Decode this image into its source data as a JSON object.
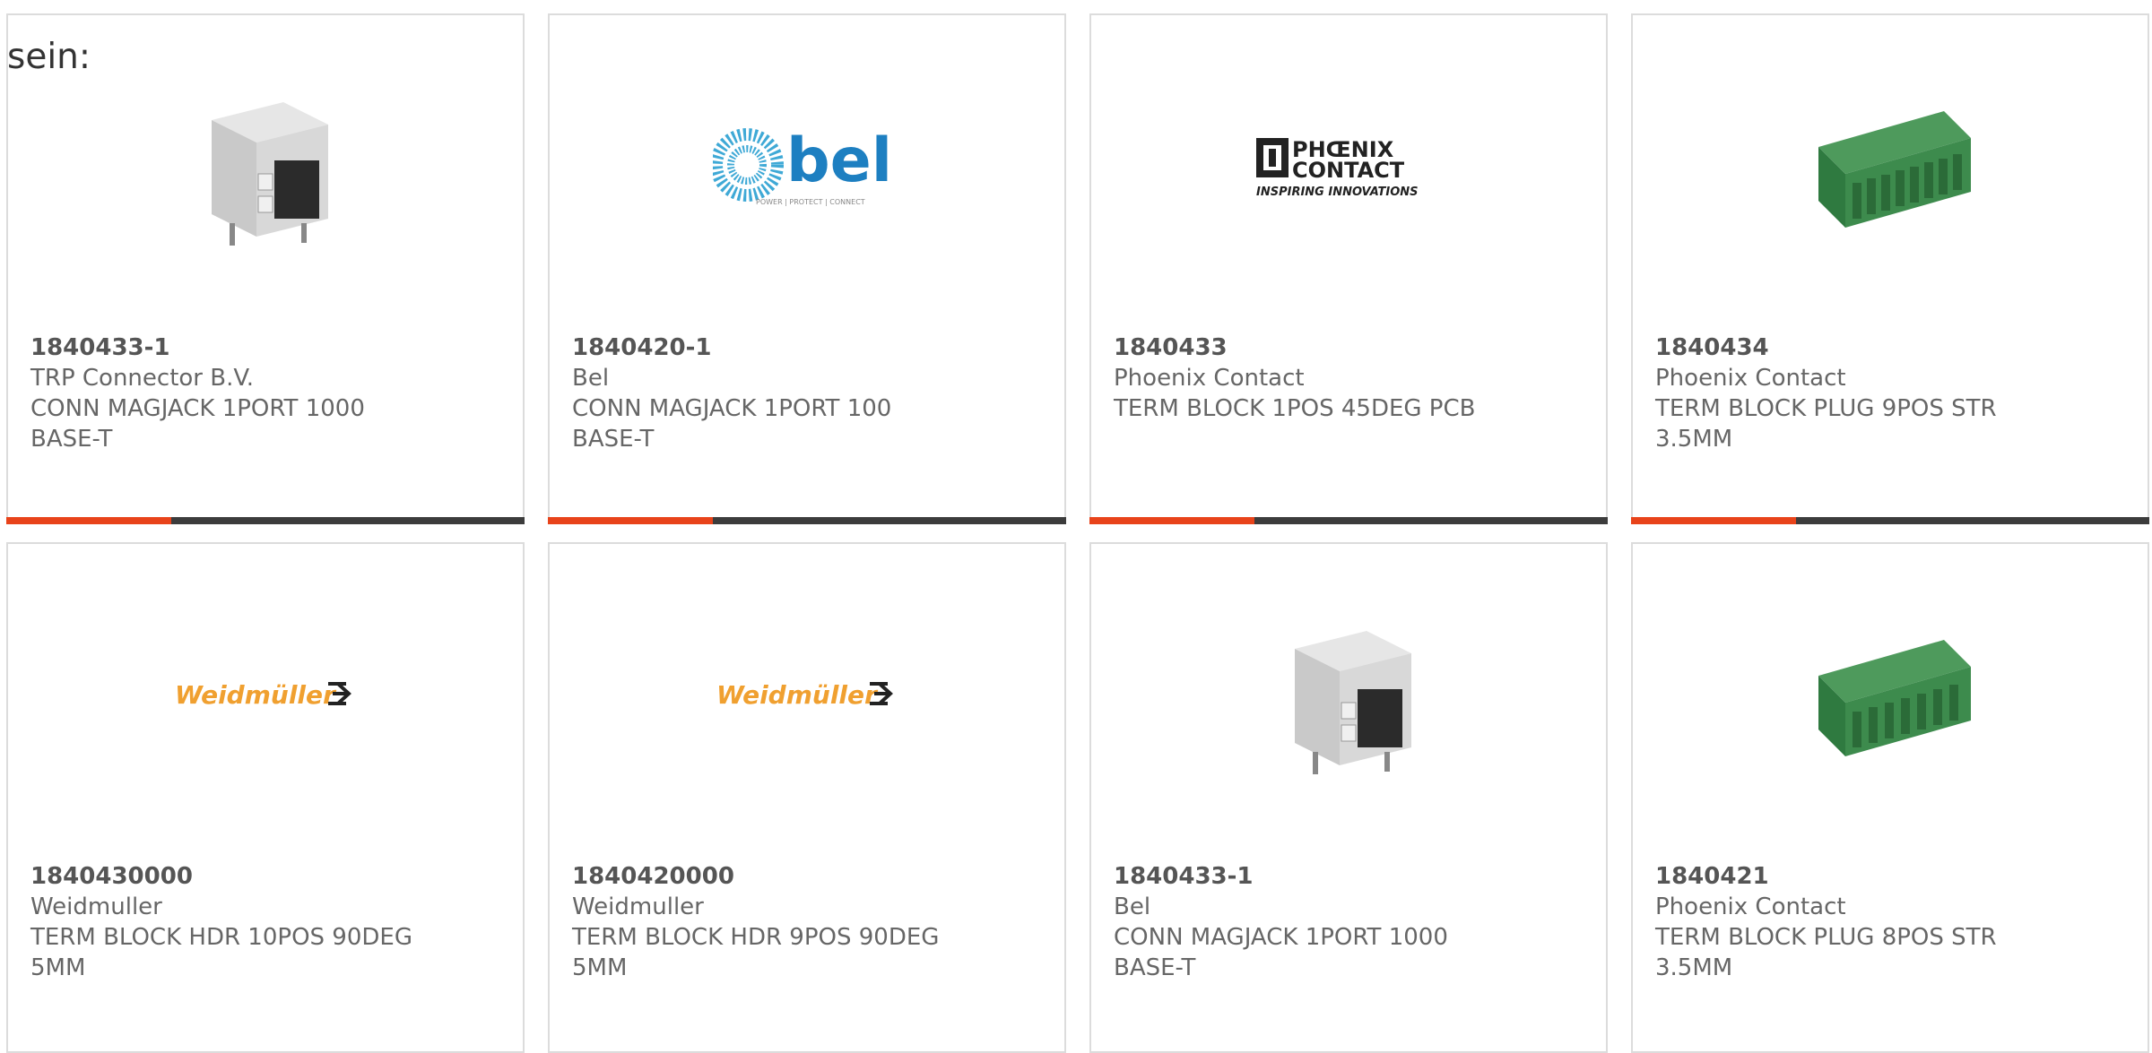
{
  "heading": "sein:",
  "colors": {
    "accent": "#e8431a",
    "bar": "#3c3c3c",
    "border": "#dcdcdc",
    "text": "#666666"
  },
  "products": [
    {
      "part_number": "1840433-1",
      "manufacturer": "TRP Connector B.V.",
      "desc_line1": "CONN MAGJACK 1PORT 1000",
      "desc_line2": "BASE-T",
      "image": "rj45-magjack"
    },
    {
      "part_number": "1840420-1",
      "manufacturer": "Bel",
      "desc_line1": "CONN MAGJACK 1PORT 100",
      "desc_line2": "BASE-T",
      "image": "bel-logo",
      "logo_text": "bel",
      "logo_tagline": "POWER | PROTECT | CONNECT"
    },
    {
      "part_number": "1840433",
      "manufacturer": "Phoenix Contact",
      "desc_line1": "TERM BLOCK 1POS 45DEG PCB",
      "desc_line2": "",
      "image": "phoenix-contact-logo",
      "logo_line1": "PHŒNIX",
      "logo_line2": "CONTACT",
      "logo_tagline": "INSPIRING INNOVATIONS"
    },
    {
      "part_number": "1840434",
      "manufacturer": "Phoenix Contact",
      "desc_line1": "TERM BLOCK PLUG 9POS STR",
      "desc_line2": "3.5MM",
      "image": "terminal-block-plug"
    },
    {
      "part_number": "1840430000",
      "manufacturer": "Weidmuller",
      "desc_line1": "TERM BLOCK HDR 10POS 90DEG",
      "desc_line2": "5MM",
      "image": "weidmuller-logo",
      "logo_text": "Weidmüller"
    },
    {
      "part_number": "1840420000",
      "manufacturer": "Weidmuller",
      "desc_line1": "TERM BLOCK HDR 9POS 90DEG",
      "desc_line2": "5MM",
      "image": "weidmuller-logo",
      "logo_text": "Weidmüller"
    },
    {
      "part_number": "1840433-1",
      "manufacturer": "Bel",
      "desc_line1": "CONN MAGJACK 1PORT 1000",
      "desc_line2": "BASE-T",
      "image": "rj45-magjack"
    },
    {
      "part_number": "1840421",
      "manufacturer": "Phoenix Contact",
      "desc_line1": "TERM BLOCK PLUG 8POS STR",
      "desc_line2": "3.5MM",
      "image": "terminal-block-plug"
    }
  ]
}
